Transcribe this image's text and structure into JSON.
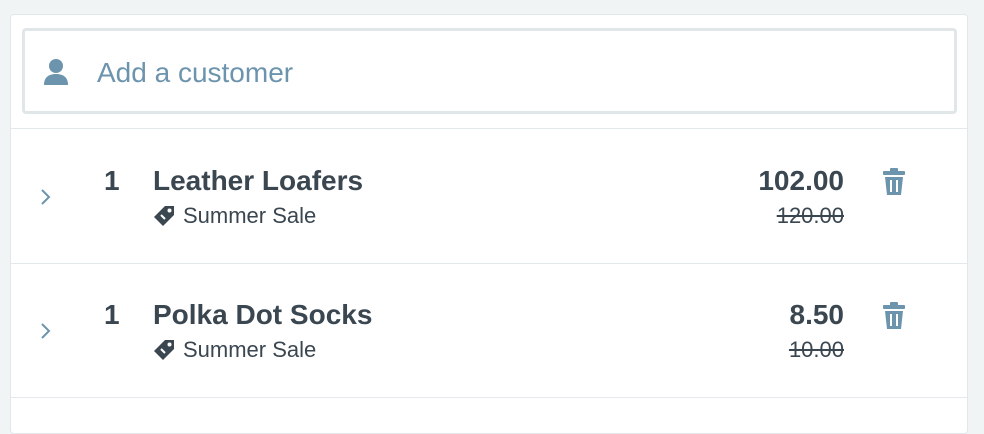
{
  "customer": {
    "placeholder": "Add a customer",
    "icon": "user-icon"
  },
  "line_items": [
    {
      "quantity": "1",
      "name": "Leather Loafers",
      "discount_label": "Summer Sale",
      "price": "102.00",
      "original_price": "120.00"
    },
    {
      "quantity": "1",
      "name": "Polka Dot Socks",
      "discount_label": "Summer Sale",
      "price": "8.50",
      "original_price": "10.00"
    }
  ],
  "icons": {
    "expand": "chevron-right-icon",
    "discount": "tag-icon",
    "remove": "trash-icon"
  },
  "colors": {
    "accent": "#6d94ad",
    "text": "#3a4650",
    "border": "#e1e7e9"
  }
}
